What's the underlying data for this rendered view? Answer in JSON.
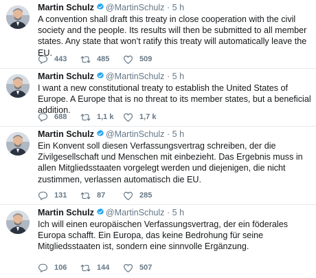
{
  "colors": {
    "verified": "#1da1f2",
    "icon": "#657786",
    "text": "#14171a",
    "divider": "#e6ecf0"
  },
  "icons": {
    "reply": "reply-icon",
    "retweet": "retweet-icon",
    "like": "heart-icon",
    "verified": "verified-badge-icon"
  },
  "tweets": [
    {
      "name": "Martin Schulz",
      "handle": "@MartinSchulz",
      "dot": "·",
      "time": "5 h",
      "text": "A convention shall draft this treaty in close cooperation with the civil society and the people. Its results will then be submitted to all member states. Any state that won’t ratify this treaty will automatically leave the EU.",
      "replies": "443",
      "retweets": "485",
      "likes": "509"
    },
    {
      "name": "Martin Schulz",
      "handle": "@MartinSchulz",
      "dot": "·",
      "time": "5 h",
      "text": "I want a new constitutional treaty to establish the United States of Europe. A Europe that is no threat to its member states, but a beneficial addition.",
      "replies": "688",
      "retweets": "1,1 k",
      "likes": "1,7 k"
    },
    {
      "name": "Martin Schulz",
      "handle": "@MartinSchulz",
      "dot": "·",
      "time": "5 h",
      "text": "Ein Konvent soll diesen Verfassungsvertrag schreiben, der die Zivilgesellschaft und Menschen mit einbezieht. Das Ergebnis muss in allen Mitgliedsstaaten vorgelegt werden und diejenigen, die nicht zustimmen, verlassen automatisch die EU.",
      "replies": "131",
      "retweets": "87",
      "likes": "285"
    },
    {
      "name": "Martin Schulz",
      "handle": "@MartinSchulz",
      "dot": "·",
      "time": "5 h",
      "text": "Ich will einen europäischen Verfassungsvertrag, der ein föderales Europa schafft. Ein Europa, das keine Bedrohung für seine Mitgliedsstaaten ist, sondern eine sinnvolle Ergänzung.",
      "replies": "106",
      "retweets": "144",
      "likes": "507"
    }
  ]
}
